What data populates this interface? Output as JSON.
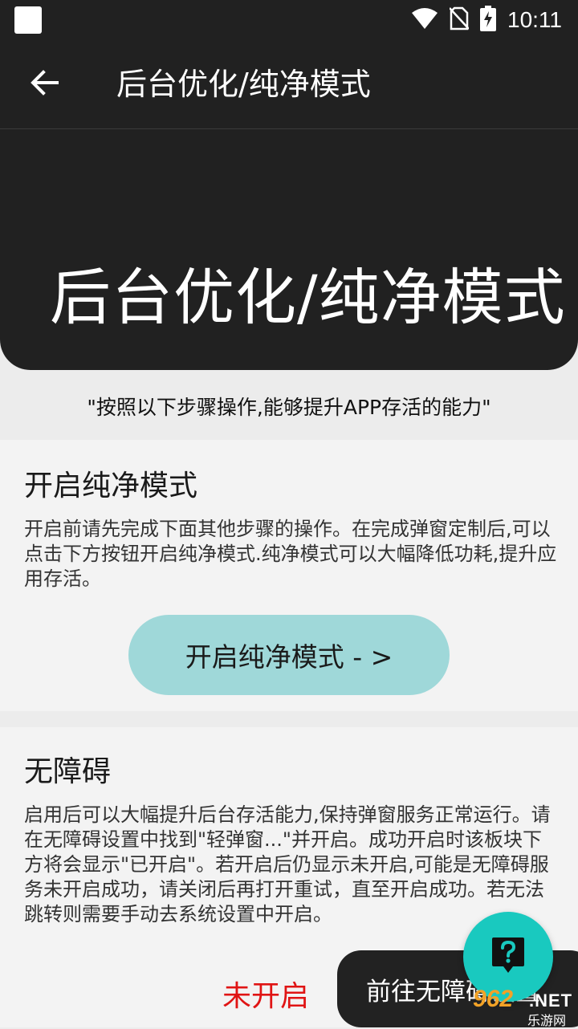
{
  "status_bar": {
    "time": "10:11",
    "icons": [
      "wifi-icon",
      "no-sim-icon",
      "battery-charging-icon"
    ]
  },
  "app_bar": {
    "title": "后台优化/纯净模式",
    "back_icon": "arrow-left-icon"
  },
  "hero": {
    "title": "后台优化/纯净模式"
  },
  "tagline": "\"按照以下步骤操作,能够提升APP存活的能力\"",
  "pure_mode_card": {
    "title": "开启纯净模式",
    "description": "开启前请先完成下面其他步骤的操作。在完成弹窗定制后,可以点击下方按钮开启纯净模式.纯净模式可以大幅降低功耗,提升应用存活。",
    "button_label": "开启纯净模式 - >"
  },
  "accessibility_card": {
    "title": "无障碍",
    "description": "启用后可以大幅提升后台存活能力,保持弹窗服务正常运行。请在无障碍设置中找到\"轻弹窗...\"并开启。成功开启时该板块下方将会显示\"已开启\"。若开启后仍显示未开启,可能是无障碍服务未开启成功，请关闭后再打开重试，直至开启成功。若无法跳转则需要手动去系统设置中开启。",
    "status": "未开启",
    "status_color": "#e01414",
    "button_label": "前往无障碍设置"
  },
  "fab": {
    "icon": "help-chat-icon",
    "color": "#19c9bf"
  },
  "watermark": {
    "number": "962",
    "suffix": ".NET",
    "site": "乐游网"
  },
  "colors": {
    "dark": "#212121",
    "pill": "#9fd8d9",
    "background": "#ececec"
  }
}
